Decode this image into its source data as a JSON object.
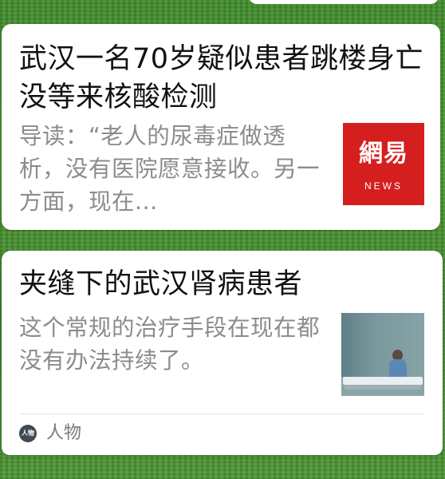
{
  "articles": [
    {
      "title": "武汉一名70岁疑似患者跳楼身亡 没等来核酸检测",
      "summary": "导读：“老人的尿毒症做透析，没有医院愿意接收。另一方面，现在...",
      "thumbnail": {
        "brand": "網易",
        "sub": "NEWS",
        "color": "#d51f1f"
      }
    },
    {
      "title": "夹缝下的武汉肾病患者",
      "summary": "这个常规的治疗手段在现在都没有办法持续了。",
      "source": "人物"
    }
  ]
}
